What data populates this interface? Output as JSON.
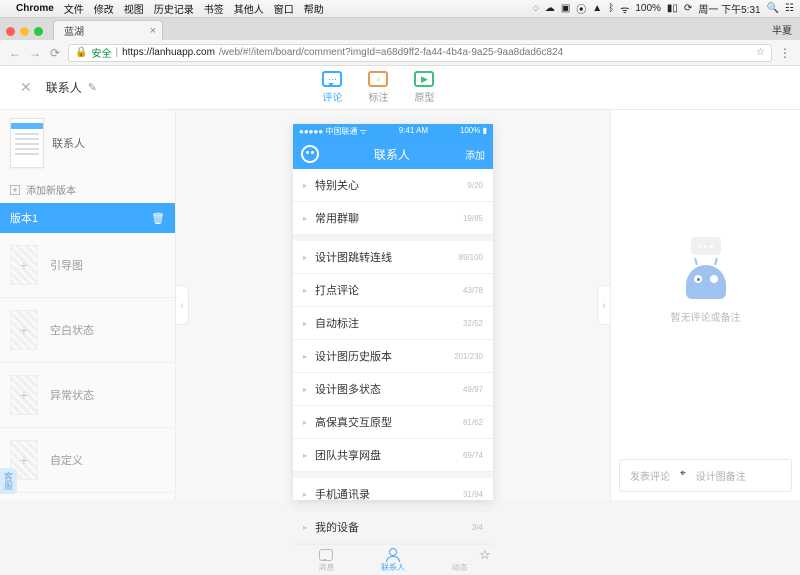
{
  "mac": {
    "app": "Chrome",
    "menus": [
      "文件",
      "修改",
      "视图",
      "历史记录",
      "书签",
      "其他人",
      "窗口",
      "帮助"
    ],
    "battery": "100%",
    "clock": "周一 下午5:31",
    "user": "半夏"
  },
  "chrome": {
    "tab_title": "蓝湖",
    "secure_label": "安全",
    "url_host": "https://lanhuapp.com",
    "url_path": "/web/#!/item/board/comment?imgId=a68d9ff2-fa44-4b4a-9a25-9aa8dad6c824"
  },
  "header": {
    "title": "联系人",
    "tabs": [
      {
        "label": "评论"
      },
      {
        "label": "标注"
      },
      {
        "label": "原型"
      }
    ]
  },
  "sidebar": {
    "thumb_label": "联系人",
    "add_version": "添加新版本",
    "active_version": "版本1",
    "items": [
      "引导图",
      "空白状态",
      "异常状态",
      "自定义"
    ]
  },
  "phone": {
    "status_left": "●●●●● 中国联通",
    "status_wifi": "ᯤ",
    "status_time": "9:41 AM",
    "status_right": "100% ▮",
    "nav_title": "联系人",
    "nav_right": "添加",
    "cells": [
      {
        "text": "特别关心",
        "count": "9/20",
        "sep": false
      },
      {
        "text": "常用群聊",
        "count": "19/85",
        "sep": false
      },
      {
        "text": "设计图跳转连线",
        "count": "89/100",
        "sep": true
      },
      {
        "text": "打点评论",
        "count": "43/78",
        "sep": false
      },
      {
        "text": "自动标注",
        "count": "32/52",
        "sep": false
      },
      {
        "text": "设计图历史版本",
        "count": "201/230",
        "sep": false
      },
      {
        "text": "设计图多状态",
        "count": "49/97",
        "sep": false
      },
      {
        "text": "高保真交互原型",
        "count": "81/62",
        "sep": false
      },
      {
        "text": "团队共享网盘",
        "count": "69/74",
        "sep": false
      },
      {
        "text": "手机通讯录",
        "count": "31/94",
        "sep": true
      },
      {
        "text": "我的设备",
        "count": "3/4",
        "sep": false
      }
    ],
    "tabbar": [
      {
        "label": "消息"
      },
      {
        "label": "联系人"
      },
      {
        "label": "动态"
      }
    ]
  },
  "right": {
    "empty_text": "暂无评论或备注",
    "compose_left": "发表评论",
    "compose_right": "设计图备注"
  }
}
